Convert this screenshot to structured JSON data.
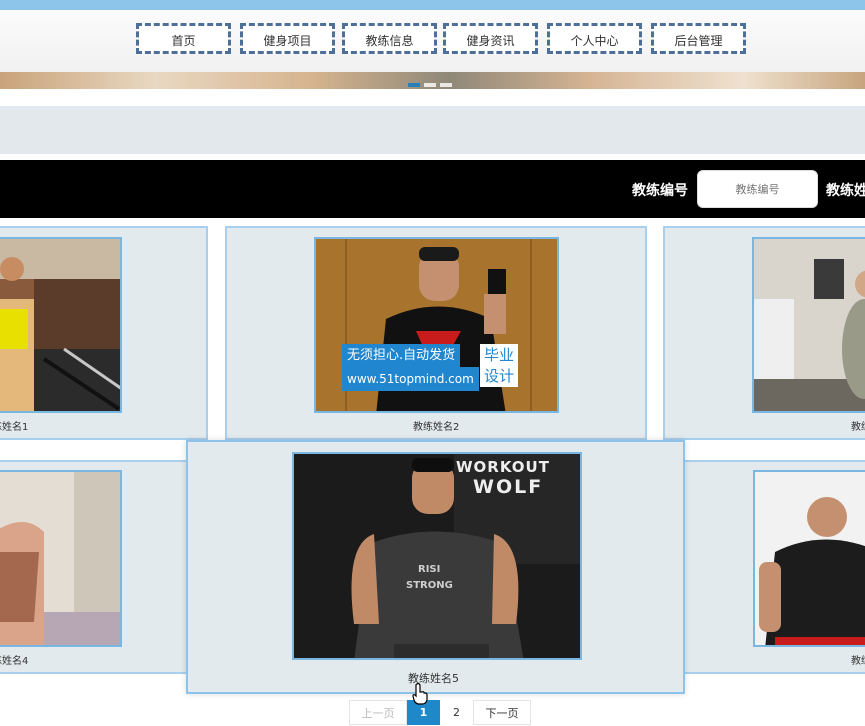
{
  "nav": {
    "items": [
      "首页",
      "健身项目",
      "教练信息",
      "健身资讯",
      "个人中心",
      "后台管理"
    ]
  },
  "search": {
    "label": "教练编号",
    "placeholder": "教练编号",
    "label2_partial": "教练姓"
  },
  "cards": [
    {
      "name": "练姓名1"
    },
    {
      "name": "教练姓名2"
    },
    {
      "name": "教练"
    },
    {
      "name": "练姓名4"
    },
    {
      "name": "教练姓名5"
    },
    {
      "name": "教练"
    }
  ],
  "watermark": {
    "line1": "无须担心.自动发货",
    "line2": "www.51topmind.com",
    "tag1": "毕业",
    "tag2": "设计"
  },
  "photo_text": {
    "workout": "WORKOUT",
    "wolf": "WOLF",
    "shirt1": "RISI",
    "shirt2": "STRONG"
  },
  "pager": {
    "prev": "上一页",
    "pages": [
      "1",
      "2"
    ],
    "current": "1",
    "next": "下一页"
  },
  "colors": {
    "nav_border": "#4d6f9a",
    "top_strip": "#8cc4ea",
    "pager_active": "#1e88c9",
    "card_bg": "#e2eaee"
  }
}
